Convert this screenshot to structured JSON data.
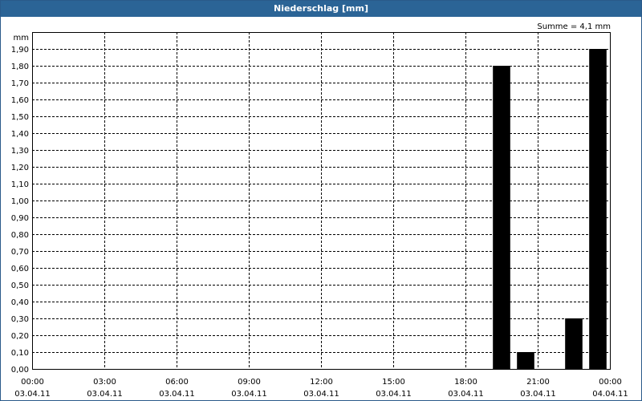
{
  "window": {
    "title": "Niederschlag [mm]"
  },
  "chart_data": {
    "type": "bar",
    "title": "Niederschlag [mm]",
    "ylabel": "mm",
    "annotation": "Summe = 4,1 mm",
    "ylim": [
      0,
      2.0
    ],
    "y_ticks": [
      "0,00",
      "0,10",
      "0,20",
      "0,30",
      "0,40",
      "0,50",
      "0,60",
      "0,70",
      "0,80",
      "0,90",
      "1,00",
      "1,10",
      "1,20",
      "1,30",
      "1,40",
      "1,50",
      "1,60",
      "1,70",
      "1,80",
      "1,90"
    ],
    "x_range_hours": [
      0,
      24
    ],
    "x_ticks": [
      {
        "time": "00:00",
        "date": "03.04.11"
      },
      {
        "time": "03:00",
        "date": "03.04.11"
      },
      {
        "time": "06:00",
        "date": "03.04.11"
      },
      {
        "time": "09:00",
        "date": "03.04.11"
      },
      {
        "time": "12:00",
        "date": "03.04.11"
      },
      {
        "time": "15:00",
        "date": "03.04.11"
      },
      {
        "time": "18:00",
        "date": "03.04.11"
      },
      {
        "time": "21:00",
        "date": "03.04.11"
      },
      {
        "time": "00:00",
        "date": "04.04.11"
      }
    ],
    "bars": [
      {
        "start": "19:00",
        "end": "20:00",
        "value": 1.8
      },
      {
        "start": "20:00",
        "end": "21:00",
        "value": 0.1
      },
      {
        "start": "22:00",
        "end": "23:00",
        "value": 0.3
      },
      {
        "start": "23:00",
        "end": "00:00",
        "value": 1.9
      }
    ],
    "grid": true,
    "bar_color": "#000000"
  }
}
